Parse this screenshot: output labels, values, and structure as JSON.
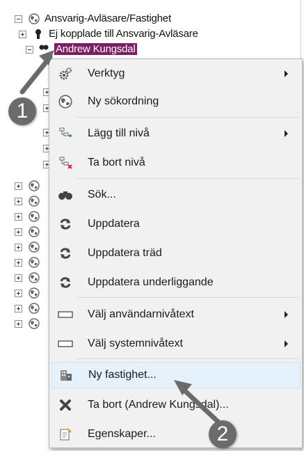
{
  "tree": {
    "root_label": "Ansvarig-Avläsare/Fastighet",
    "child1_label": "Ej kopplade till Ansvarig-Avläsare",
    "child2_label": "Andrew Kungsdal"
  },
  "context_menu": {
    "items": [
      {
        "label": "Verktyg",
        "icon": "gears-icon",
        "submenu": true
      },
      {
        "label": "Ny sökordning",
        "icon": "globe-icon",
        "submenu": false
      },
      {
        "label": "Lägg till nivå",
        "icon": "add-level-icon",
        "submenu": true
      },
      {
        "label": "Ta bort nivå",
        "icon": "remove-level-icon",
        "submenu": false
      },
      {
        "label": "Sök...",
        "icon": "binoculars-icon",
        "submenu": false
      },
      {
        "label": "Uppdatera",
        "icon": "refresh-icon",
        "submenu": false
      },
      {
        "label": "Uppdatera träd",
        "icon": "refresh-icon",
        "submenu": false
      },
      {
        "label": "Uppdatera underliggande",
        "icon": "refresh-icon",
        "submenu": false
      },
      {
        "label": "Välj användarnivåtext",
        "icon": "textbox-icon",
        "submenu": true
      },
      {
        "label": "Välj systemnivåtext",
        "icon": "textbox-icon",
        "submenu": true
      },
      {
        "label": "Ny fastighet...",
        "icon": "building-icon",
        "submenu": false,
        "highlighted": true
      },
      {
        "label": "Ta bort (Andrew Kungsdal)...",
        "icon": "delete-icon",
        "submenu": false
      },
      {
        "label": "Egenskaper...",
        "icon": "properties-icon",
        "submenu": false
      }
    ]
  },
  "annotations": {
    "step1": "1",
    "step2": "2"
  },
  "colors": {
    "selection": "#7b1f62",
    "menu_bg": "#f1f1f1",
    "highlight": "#e5f1fb",
    "badge": "#6b6b6b"
  }
}
